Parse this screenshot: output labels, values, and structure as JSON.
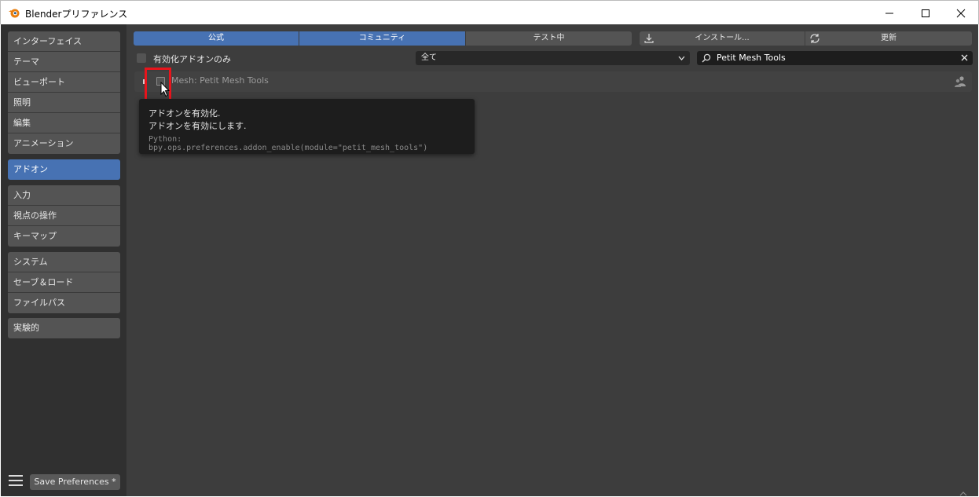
{
  "window": {
    "title": "Blenderプリファレンス",
    "minimize_icon": "minimize-icon",
    "maximize_icon": "maximize-icon",
    "close_icon": "close-icon",
    "app_icon": "blender-logo-icon"
  },
  "sidebar": {
    "groups": [
      {
        "items": [
          {
            "label": "インターフェイス"
          },
          {
            "label": "テーマ"
          },
          {
            "label": "ビューポート"
          },
          {
            "label": "照明"
          },
          {
            "label": "編集"
          },
          {
            "label": "アニメーション"
          }
        ]
      },
      {
        "items": [
          {
            "label": "アドオン",
            "active": true
          }
        ]
      },
      {
        "items": [
          {
            "label": "入力"
          },
          {
            "label": "視点の操作"
          },
          {
            "label": "キーマップ"
          }
        ]
      },
      {
        "items": [
          {
            "label": "システム"
          },
          {
            "label": "セーブ＆ロード"
          },
          {
            "label": "ファイルパス"
          }
        ]
      },
      {
        "items": [
          {
            "label": "実験的"
          }
        ]
      }
    ],
    "save_button": "Save Preferences *"
  },
  "tabs": [
    {
      "label": "公式",
      "active": true
    },
    {
      "label": "コミュニティ",
      "active": true
    },
    {
      "label": "テスト中",
      "active": false
    }
  ],
  "toolbar": {
    "install_label": "インストール...",
    "refresh_label": "更新"
  },
  "filter": {
    "enabled_only_label": "有効化アドオンのみ",
    "category_value": "全て",
    "search_value": "Petit Mesh Tools"
  },
  "addon": {
    "name": "Mesh: Petit Mesh Tools"
  },
  "tooltip": {
    "title": "アドオンを有効化.",
    "description": "アドオンを有効にします.",
    "python": "Python: bpy.ops.preferences.addon_enable(module=\"petit_mesh_tools\")"
  },
  "colors": {
    "accent": "#4772b3",
    "highlight": "#e8141c"
  }
}
